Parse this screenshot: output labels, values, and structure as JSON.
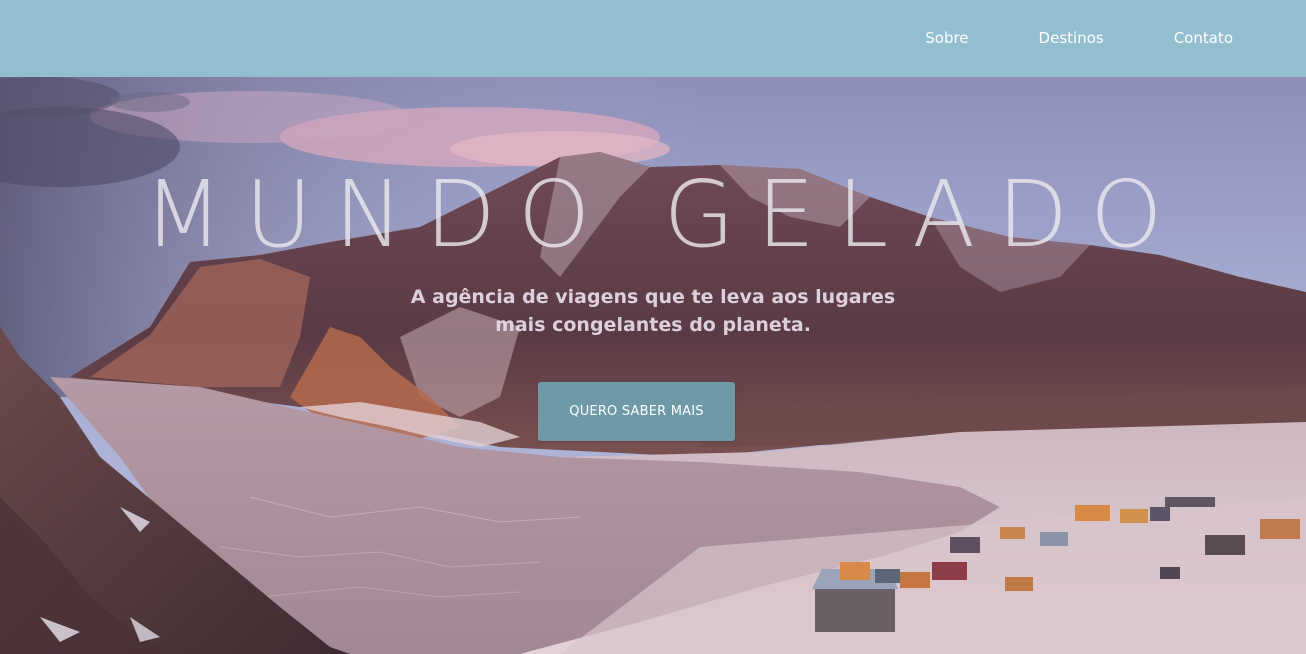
{
  "header": {
    "nav": {
      "sobre": "Sobre",
      "destinos": "Destinos",
      "contato": "Contato"
    }
  },
  "hero": {
    "title": "MUNDO GELADO",
    "subtitle_line1": "A agência de viagens que te leva aos lugares",
    "subtitle_line2": "mais congelantes do planeta.",
    "cta_label": "QUERO SABER MAIS"
  },
  "colors": {
    "header_bg": "#93bed0",
    "cta_bg": "#6e9aa8"
  }
}
